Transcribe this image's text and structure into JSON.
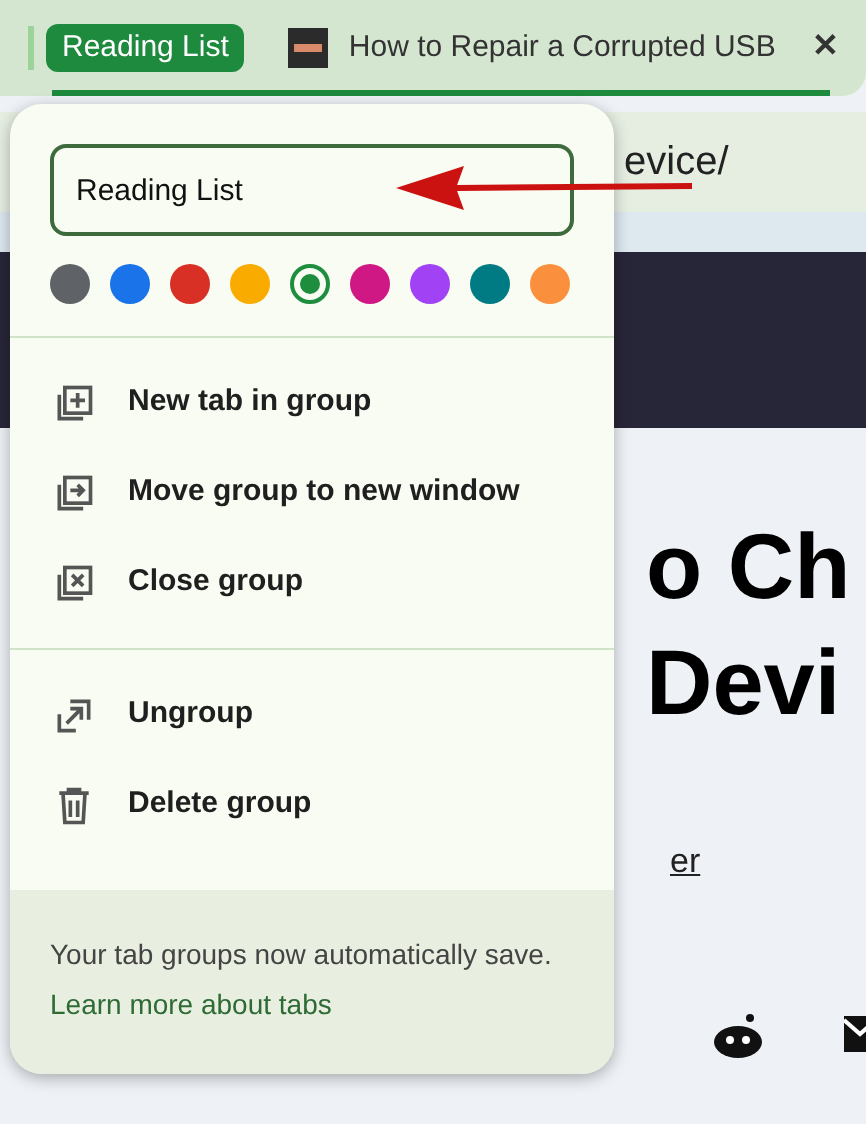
{
  "tab_strip": {
    "group_chip": {
      "label": "Reading List",
      "color": "#1e8a3e"
    },
    "tab": {
      "title": "How to Repair a Corrupted USB",
      "close": "✕"
    }
  },
  "address_bar": {
    "url_tail": "evice/"
  },
  "page": {
    "heading_lines": [
      "o Ch",
      "Devi"
    ],
    "link_text": "er"
  },
  "popup": {
    "name_field": {
      "value": "Reading List"
    },
    "colors": [
      {
        "color": "#5f6368",
        "selected": false
      },
      {
        "color": "#1a73e8",
        "selected": false
      },
      {
        "color": "#d93025",
        "selected": false
      },
      {
        "color": "#f9ab00",
        "selected": false
      },
      {
        "color": "#1e8e3e",
        "selected": true
      },
      {
        "color": "#d01884",
        "selected": false
      },
      {
        "color": "#a142f4",
        "selected": false
      },
      {
        "color": "#007b83",
        "selected": false
      },
      {
        "color": "#fa903e",
        "selected": false
      }
    ],
    "sections": [
      [
        {
          "kind": "new-tab",
          "label": "New tab in group"
        },
        {
          "kind": "move",
          "label": "Move group to new window"
        },
        {
          "kind": "close",
          "label": "Close group"
        }
      ],
      [
        {
          "kind": "ungroup",
          "label": "Ungroup"
        },
        {
          "kind": "delete",
          "label": "Delete group"
        }
      ]
    ],
    "footer": {
      "text": "Your tab groups now automatically save.",
      "link": "Learn more about tabs"
    }
  }
}
